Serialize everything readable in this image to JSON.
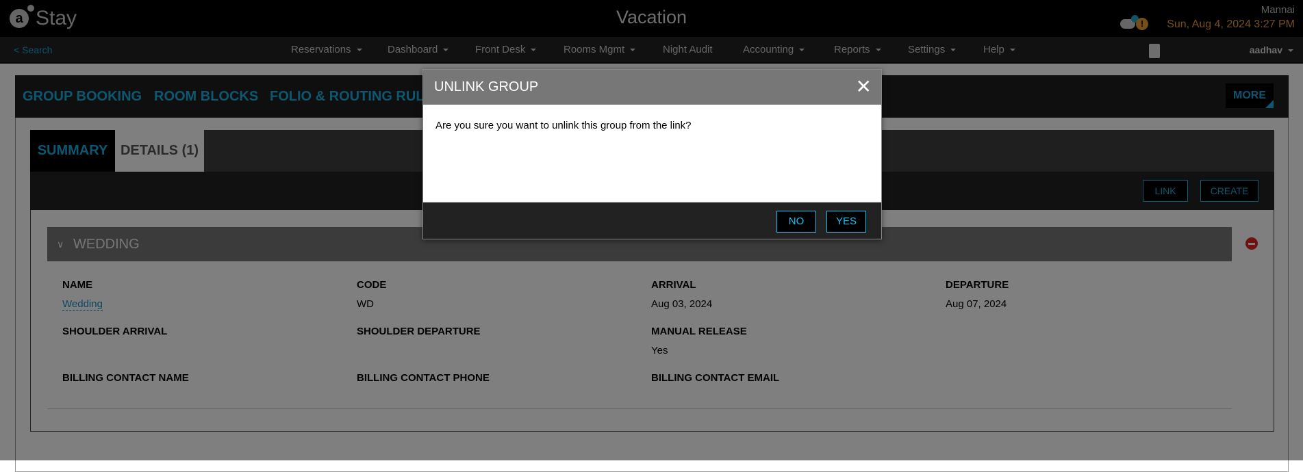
{
  "header": {
    "logo_text": "Stay",
    "app_title": "Vacation",
    "hotel": "Mannai",
    "datetime": "Sun, Aug 4, 2024 3:27 PM",
    "user": "aadhav"
  },
  "nav": {
    "back": "< Search",
    "items": [
      "Reservations",
      "Dashboard",
      "Front Desk",
      "Rooms Mgmt",
      "Night Audit",
      "Accounting",
      "Reports",
      "Settings",
      "Help"
    ]
  },
  "main_tabs": [
    "GROUP BOOKING",
    "ROOM BLOCKS",
    "FOLIO & ROUTING RULES"
  ],
  "more": "MORE",
  "sub_tabs": {
    "summary": "SUMMARY",
    "details": "DETAILS (1)"
  },
  "toolbar": {
    "link": "LINK",
    "create": "CREATE"
  },
  "group": {
    "title": "WEDDING",
    "fields": [
      {
        "label": "NAME",
        "value": "Wedding"
      },
      {
        "label": "CODE",
        "value": "WD"
      },
      {
        "label": "ARRIVAL",
        "value": "Aug 03, 2024"
      },
      {
        "label": "DEPARTURE",
        "value": "Aug 07, 2024"
      },
      {
        "label": "SHOULDER ARRIVAL",
        "value": ""
      },
      {
        "label": "SHOULDER DEPARTURE",
        "value": ""
      },
      {
        "label": "MANUAL RELEASE",
        "value": "Yes"
      },
      {
        "label": "BILLING CONTACT NAME",
        "value": ""
      },
      {
        "label": "BILLING CONTACT PHONE",
        "value": ""
      },
      {
        "label": "BILLING CONTACT EMAIL",
        "value": ""
      }
    ]
  },
  "dialog": {
    "title": "UNLINK GROUP",
    "message": "Are you sure you want to unlink this group from the link?",
    "no": "NO",
    "yes": "YES",
    "close": "✕"
  },
  "colors": {
    "accent": "#1aaee0",
    "date": "#e8a030",
    "danger": "#e02020"
  }
}
